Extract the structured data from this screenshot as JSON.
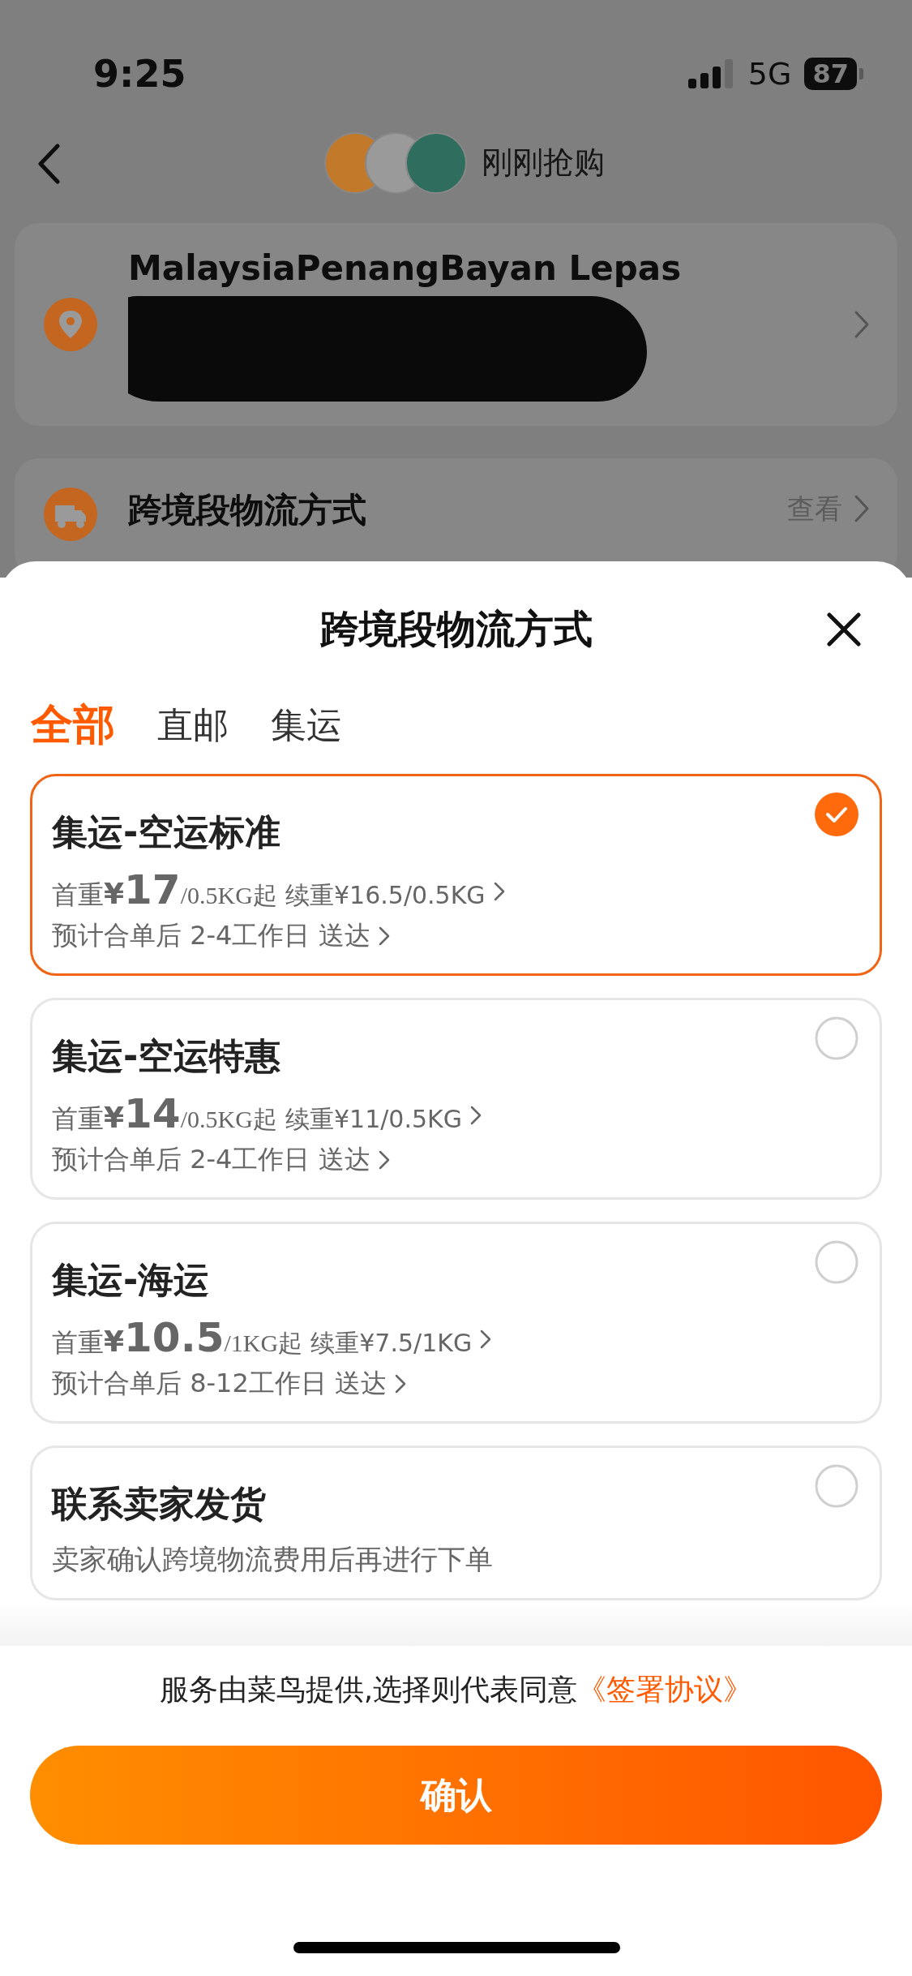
{
  "status_bar": {
    "time": "9:25",
    "network": "5G",
    "battery": "87"
  },
  "nav": {
    "title": "刚刚抢购"
  },
  "address": {
    "line_1": "MalaysiaPenangBayan Lepas"
  },
  "shipping_row": {
    "label": "跨境段物流方式",
    "action": "查看"
  },
  "sheet": {
    "title": "跨境段物流方式",
    "tabs": [
      {
        "label": "全部",
        "selected": true
      },
      {
        "label": "直邮",
        "selected": false
      },
      {
        "label": "集运",
        "selected": false
      }
    ],
    "options": [
      {
        "kind": "rate",
        "title": "集运-空运标准",
        "first_label": "首重",
        "currency": "¥",
        "first_price": "17",
        "first_unit": "/0.5KG起",
        "renewal": "续重¥16.5/0.5KG",
        "eta": "预计合单后 2-4工作日 送达",
        "selected": true
      },
      {
        "kind": "rate",
        "title": "集运-空运特惠",
        "first_label": "首重",
        "currency": "¥",
        "first_price": "14",
        "first_unit": "/0.5KG起",
        "renewal": "续重¥11/0.5KG",
        "eta": "预计合单后 2-4工作日 送达",
        "selected": false
      },
      {
        "kind": "rate",
        "title": "集运-海运",
        "first_label": "首重",
        "currency": "¥",
        "first_price": "10.5",
        "first_unit": "/1KG起",
        "renewal": "续重¥7.5/1KG",
        "eta": "预计合单后 8-12工作日 送达",
        "selected": false
      },
      {
        "kind": "note",
        "title": "联系卖家发货",
        "note": "卖家确认跨境物流费用后再进行下单",
        "selected": false
      }
    ],
    "agreement": {
      "text": "服务由菜鸟提供,选择则代表同意",
      "link": "《签署协议》"
    },
    "confirm": "确认"
  }
}
